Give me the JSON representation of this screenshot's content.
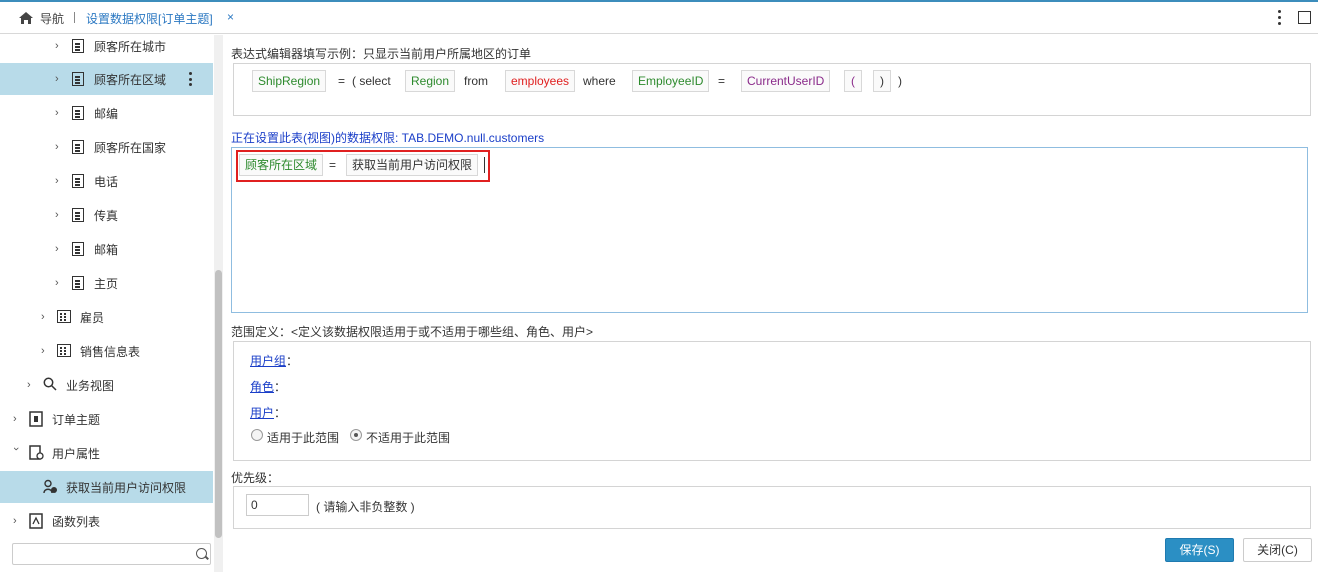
{
  "tabs": {
    "home_label": "导航",
    "active_label": "设置数据权限[订单主题]",
    "close_glyph": "×"
  },
  "sidebar": {
    "items": [
      {
        "label": "顾客所在城市"
      },
      {
        "label": "顾客所在区域"
      },
      {
        "label": "邮编"
      },
      {
        "label": "顾客所在国家"
      },
      {
        "label": "电话"
      },
      {
        "label": "传真"
      },
      {
        "label": "邮箱"
      },
      {
        "label": "主页"
      },
      {
        "label": "雇员"
      },
      {
        "label": "销售信息表"
      },
      {
        "label": "业务视图"
      },
      {
        "label": "订单主题"
      },
      {
        "label": "用户属性"
      },
      {
        "label": "获取当前用户访问权限"
      },
      {
        "label": "函数列表"
      }
    ],
    "search_placeholder": ""
  },
  "example": {
    "title": "表达式编辑器填写示例：只显示当前用户所属地区的订单",
    "tokens": {
      "ship_region": "ShipRegion",
      "eq1": "=",
      "open_select": "( select",
      "region": "Region",
      "from": "from",
      "employees": "employees",
      "where": "where",
      "employee_id": "EmployeeID",
      "eq2": "=",
      "current_user_id": "CurrentUserID",
      "lparen": "(",
      "rparen": ")",
      "close": ")"
    }
  },
  "permission": {
    "title": "正在设置此表(视图)的数据权限: TAB.DEMO.null.customers",
    "field_chip": "顾客所在区域",
    "eq": "=",
    "function_chip": "获取当前用户访问权限"
  },
  "scope": {
    "title": "范围定义：<定义该数据权限适用于或不适用于哪些组、角色、用户>",
    "user_group_label": "用户组",
    "role_label": "角色",
    "user_label": "用户",
    "colon": "：",
    "radio_apply": "适用于此范围",
    "radio_not_apply": "不适用于此范围",
    "selected": "not_apply"
  },
  "priority": {
    "title": "优先级：",
    "value": "0",
    "hint": "( 请输入非负整数 )"
  },
  "footer": {
    "save_label": "保存(S)",
    "close_label": "关闭(C)"
  },
  "colors": {
    "accent": "#2b8fc4",
    "selected_row": "#b8dbe9",
    "highlight_border": "#e02020"
  }
}
